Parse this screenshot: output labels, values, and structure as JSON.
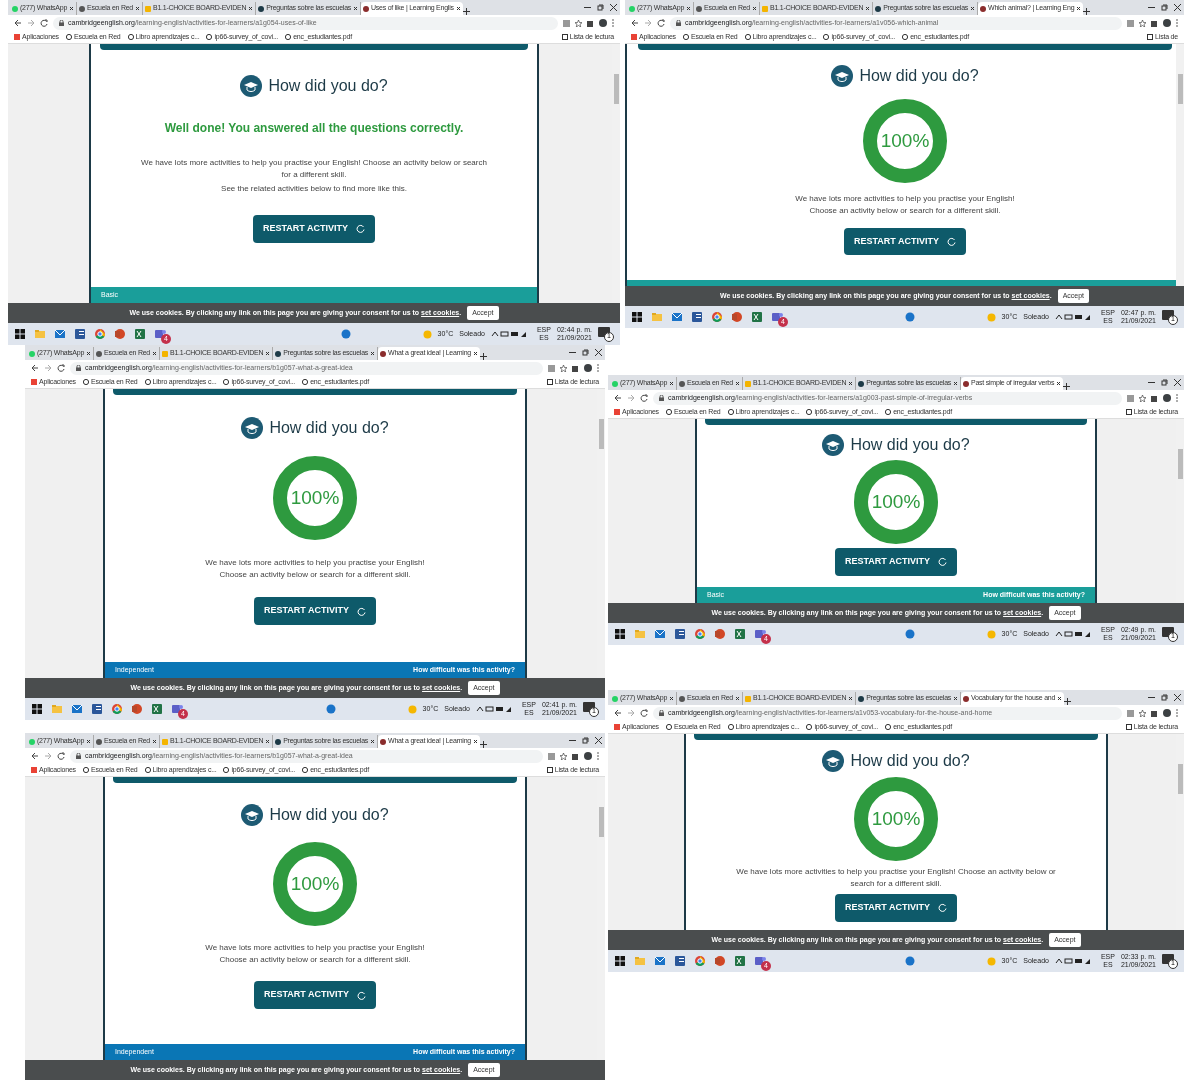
{
  "windows": [
    {
      "tabs": [
        {
          "label": "(277) WhatsApp",
          "selected": false
        },
        {
          "label": "Escuela en Red",
          "selected": false
        },
        {
          "label": "B1.1-CHOICE BOARD-EVIDEN",
          "selected": false
        },
        {
          "label": "Preguntas sobre las escuelas",
          "selected": false
        },
        {
          "label": "Uses of like | Learning Englis",
          "selected": true
        }
      ],
      "url_host": "cambridgeenglish.org",
      "url_path": "/learning-english/activities-for-learners/a1g054-uses-of-like",
      "bookmarks": [
        "Aplicaciones",
        "Escuela en Red",
        "Libro aprendizajes c...",
        "ip66-survey_of_covi...",
        "enc_estudiantes.pdf"
      ],
      "reading_list": "Lista de lectura",
      "result": {
        "title": "How did you do?",
        "kind": "message",
        "message": "Well done! You answered all the questions correctly.",
        "paragraphs": [
          "We have lots more activities to help you practise your English! Choose an activity below or search\nfor a different skill.",
          "See the related activities below to find more like this."
        ],
        "button": "RESTART ACTIVITY"
      },
      "footer": {
        "level": "Basic",
        "color": "#1a9e9a"
      },
      "cookie": {
        "text": "We use cookies. By clicking any link on this page you are giving your consent for us to",
        "link": "set cookies",
        "end": ".",
        "accept": "Accept"
      },
      "taskbar": {
        "badge": "4",
        "temperature": "30°C",
        "condition": "Soleado",
        "lang": "ESP",
        "region": "ES",
        "time": "02:44 p. m.",
        "date": "21/09/2021",
        "notifications": "1"
      }
    },
    {
      "tabs": [
        {
          "label": "(277) WhatsApp",
          "selected": false
        },
        {
          "label": "Escuela en Red",
          "selected": false
        },
        {
          "label": "B1.1-CHOICE BOARD-EVIDEN",
          "selected": false
        },
        {
          "label": "Preguntas sobre las escuelas",
          "selected": false
        },
        {
          "label": "Which animal? | Learning Eng",
          "selected": true
        }
      ],
      "url_host": "cambridgeenglish.org",
      "url_path": "/learning-english/activities-for-learners/a1v056-which-animal",
      "bookmarks": [
        "Aplicaciones",
        "Escuela en Red",
        "Libro aprendizajes c...",
        "ip66-survey_of_covi...",
        "enc_estudiantes.pdf"
      ],
      "reading_list": "Lista de",
      "result": {
        "title": "How did you do?",
        "kind": "score",
        "score": "100%",
        "paragraphs": [
          "We have lots more activities to help you practise your English!\nChoose an activity below or search for a different skill."
        ],
        "button": "RESTART ACTIVITY"
      },
      "footer": {
        "color": "#1a9e9a"
      },
      "cookie": {
        "text": "We use cookies. By clicking any link on this page you are giving your consent for us to",
        "link": "set cookies",
        "end": ".",
        "accept": "Accept"
      },
      "taskbar": {
        "badge": "4",
        "temperature": "30°C",
        "condition": "Soleado",
        "lang": "ESP",
        "region": "ES",
        "time": "02:47 p. m.",
        "date": "21/09/2021",
        "notifications": "1"
      }
    },
    {
      "tabs": [
        {
          "label": "(277) WhatsApp",
          "selected": false
        },
        {
          "label": "Escuela en Red",
          "selected": false
        },
        {
          "label": "B1.1-CHOICE BOARD-EVIDEN",
          "selected": false
        },
        {
          "label": "Preguntas sobre las escuelas",
          "selected": false
        },
        {
          "label": "What a great idea! | Learning",
          "selected": true
        }
      ],
      "url_host": "cambridgeenglish.org",
      "url_path": "/learning-english/activities-for-learners/b1g057-what-a-great-idea",
      "bookmarks": [
        "Aplicaciones",
        "Escuela en Red",
        "Libro aprendizajes c...",
        "ip66-survey_of_covi...",
        "enc_estudiantes.pdf"
      ],
      "reading_list": "Lista de lectura",
      "result": {
        "title": "How did you do?",
        "kind": "score",
        "score": "100%",
        "paragraphs": [
          "We have lots more activities to help you practise your English!\nChoose an activity below or search for a different skill."
        ],
        "button": "RESTART ACTIVITY"
      },
      "footer": {
        "level": "Independent",
        "question": "How difficult was this activity?",
        "color": "#0a76b5"
      },
      "cookie": {
        "text": "We use cookies. By clicking any link on this page you are giving your consent for us to",
        "link": "set cookies",
        "end": ".",
        "accept": "Accept"
      },
      "taskbar": {
        "badge": "4",
        "temperature": "30°C",
        "condition": "Soleado",
        "lang": "ESP",
        "region": "ES",
        "time": "02:41 p. m.",
        "date": "21/09/2021",
        "notifications": "1"
      }
    },
    {
      "tabs": [
        {
          "label": "(277) WhatsApp",
          "selected": false
        },
        {
          "label": "Escuela en Red",
          "selected": false
        },
        {
          "label": "B1.1-CHOICE BOARD-EVIDEN",
          "selected": false
        },
        {
          "label": "Preguntas sobre las escuelas",
          "selected": false
        },
        {
          "label": "Past simple of irregular verbs",
          "selected": true
        }
      ],
      "url_host": "cambridgeenglish.org",
      "url_path": "/learning-english/activities-for-learners/a1g003-past-simple-of-irregular-verbs",
      "bookmarks": [
        "Aplicaciones",
        "Escuela en Red",
        "Libro aprendizajes c...",
        "ip66-survey_of_covi...",
        "enc_estudiantes.pdf"
      ],
      "reading_list": "Lista de lectura",
      "result": {
        "title": "How did you do?",
        "kind": "score",
        "score": "100%",
        "button": "RESTART ACTIVITY"
      },
      "footer": {
        "level": "Basic",
        "question": "How difficult was this activity?",
        "color": "#1a9e9a"
      },
      "cookie": {
        "text": "We use cookies. By clicking any link on this page you are giving your consent for us to",
        "link": "set cookies",
        "end": ".",
        "accept": "Accept"
      },
      "taskbar": {
        "badge": "4",
        "temperature": "30°C",
        "condition": "Soleado",
        "lang": "ESP",
        "region": "ES",
        "time": "02:49 p. m.",
        "date": "21/09/2021",
        "notifications": "1"
      }
    },
    {
      "tabs": [
        {
          "label": "(277) WhatsApp",
          "selected": false
        },
        {
          "label": "Escuela en Red",
          "selected": false
        },
        {
          "label": "B1.1-CHOICE BOARD-EVIDEN",
          "selected": false
        },
        {
          "label": "Preguntas sobre las escuelas",
          "selected": false
        },
        {
          "label": "What a great idea! | Learning",
          "selected": true
        }
      ],
      "url_host": "cambridgeenglish.org",
      "url_path": "/learning-english/activities-for-learners/b1g057-what-a-great-idea",
      "bookmarks": [
        "Aplicaciones",
        "Escuela en Red",
        "Libro aprendizajes c...",
        "ip66-survey_of_covi...",
        "enc_estudiantes.pdf"
      ],
      "reading_list": "Lista de lectura",
      "result": {
        "title": "How did you do?",
        "kind": "score",
        "score": "100%",
        "paragraphs": [
          "We have lots more activities to help you practise your English!\nChoose an activity below or search for a different skill."
        ],
        "button": "RESTART ACTIVITY"
      },
      "footer": {
        "level": "Independent",
        "question": "How difficult was this activity?",
        "color": "#0a76b5"
      },
      "cookie": {
        "text": "We use cookies. By clicking any link on this page you are giving your consent for us to",
        "link": "set cookies",
        "end": ".",
        "accept": "Accept"
      }
    },
    {
      "tabs": [
        {
          "label": "(277) WhatsApp",
          "selected": false
        },
        {
          "label": "Escuela en Red",
          "selected": false
        },
        {
          "label": "B1.1-CHOICE BOARD-EVIDEN",
          "selected": false
        },
        {
          "label": "Preguntas sobre las escuelas",
          "selected": false
        },
        {
          "label": "Vocabulary for the house and",
          "selected": true
        }
      ],
      "url_host": "cambridgeenglish.org",
      "url_path": "/learning-english/activities-for-learners/a1v053-vocabulary-for-the-house-and-home",
      "bookmarks": [
        "Aplicaciones",
        "Escuela en Red",
        "Libro aprendizajes c...",
        "ip66-survey_of_covi...",
        "enc_estudiantes.pdf"
      ],
      "reading_list": "Lista de lectura",
      "result": {
        "title": "How did you do?",
        "kind": "score",
        "score": "100%",
        "paragraphs": [
          "We have lots more activities to help you practise your English! Choose an activity below or\nsearch for a different skill."
        ],
        "button": "RESTART ACTIVITY"
      },
      "cookie": {
        "text": "We use cookies. By clicking any link on this page you are giving your consent for us to",
        "link": "set cookies",
        "end": ".",
        "accept": "Accept"
      },
      "taskbar": {
        "badge": "4",
        "temperature": "30°C",
        "condition": "Soleado",
        "lang": "ESP",
        "region": "ES",
        "time": "02:33 p. m.",
        "date": "21/09/2021",
        "notifications": "1"
      }
    }
  ]
}
